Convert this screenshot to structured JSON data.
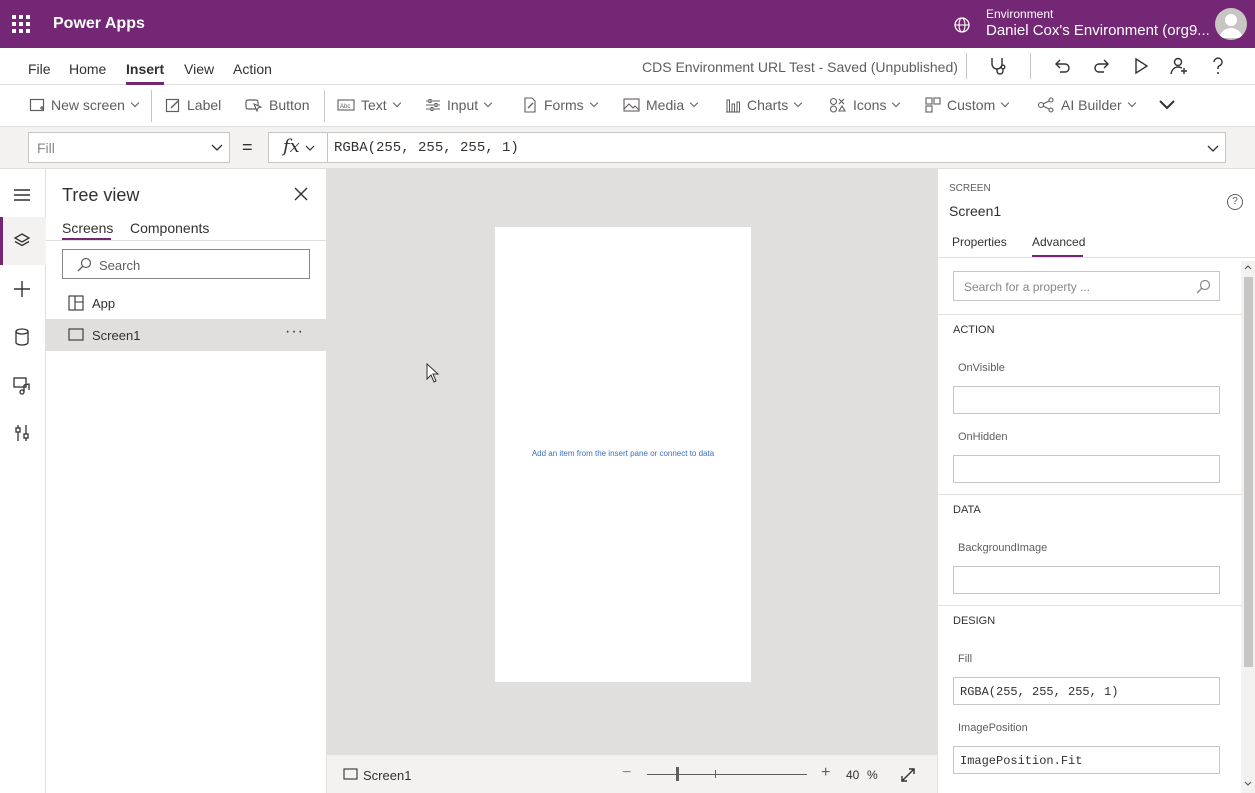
{
  "topbar": {
    "app_title": "Power Apps",
    "env_label": "Environment",
    "env_name": "Daniel Cox's Environment (org9..."
  },
  "menu": {
    "items": [
      "File",
      "Home",
      "Insert",
      "View",
      "Action"
    ],
    "active": "Insert",
    "doc_status": "CDS Environment URL Test - Saved (Unpublished)"
  },
  "ribbon": {
    "new_screen": "New screen",
    "label": "Label",
    "button": "Button",
    "text": "Text",
    "input": "Input",
    "forms": "Forms",
    "media": "Media",
    "charts": "Charts",
    "icons": "Icons",
    "custom": "Custom",
    "ai_builder": "AI Builder"
  },
  "formula": {
    "property": "Fill",
    "equals": "=",
    "fx": "fx",
    "value": "RGBA(255, 255, 255, 1)"
  },
  "tree": {
    "title": "Tree view",
    "tabs": [
      "Screens",
      "Components"
    ],
    "search_placeholder": "Search",
    "items": [
      "App",
      "Screen1"
    ],
    "more": "···"
  },
  "canvas": {
    "hint": "Add an item from the insert pane or connect to data"
  },
  "statusbar": {
    "screen": "Screen1",
    "zoom_minus": "−",
    "zoom_plus": "+",
    "zoom": "40",
    "zoom_unit": "%"
  },
  "props": {
    "kind": "SCREEN",
    "name": "Screen1",
    "help": "?",
    "tabs": [
      "Properties",
      "Advanced"
    ],
    "active_tab": "Advanced",
    "search_placeholder": "Search for a property ...",
    "sections": {
      "action": "ACTION",
      "data": "DATA",
      "design": "DESIGN"
    },
    "fields": {
      "onvisible_label": "OnVisible",
      "onvisible_value": "",
      "onhidden_label": "OnHidden",
      "onhidden_value": "",
      "bgimage_label": "BackgroundImage",
      "bgimage_value": "",
      "fill_label": "Fill",
      "fill_value": "RGBA(255, 255, 255, 1)",
      "imgpos_label": "ImagePosition",
      "imgpos_value": "ImagePosition.Fit"
    }
  },
  "colors": {
    "brand": "#742774",
    "canvas_bg": "#e1dfdd",
    "hint_text": "#3a6fc0"
  }
}
